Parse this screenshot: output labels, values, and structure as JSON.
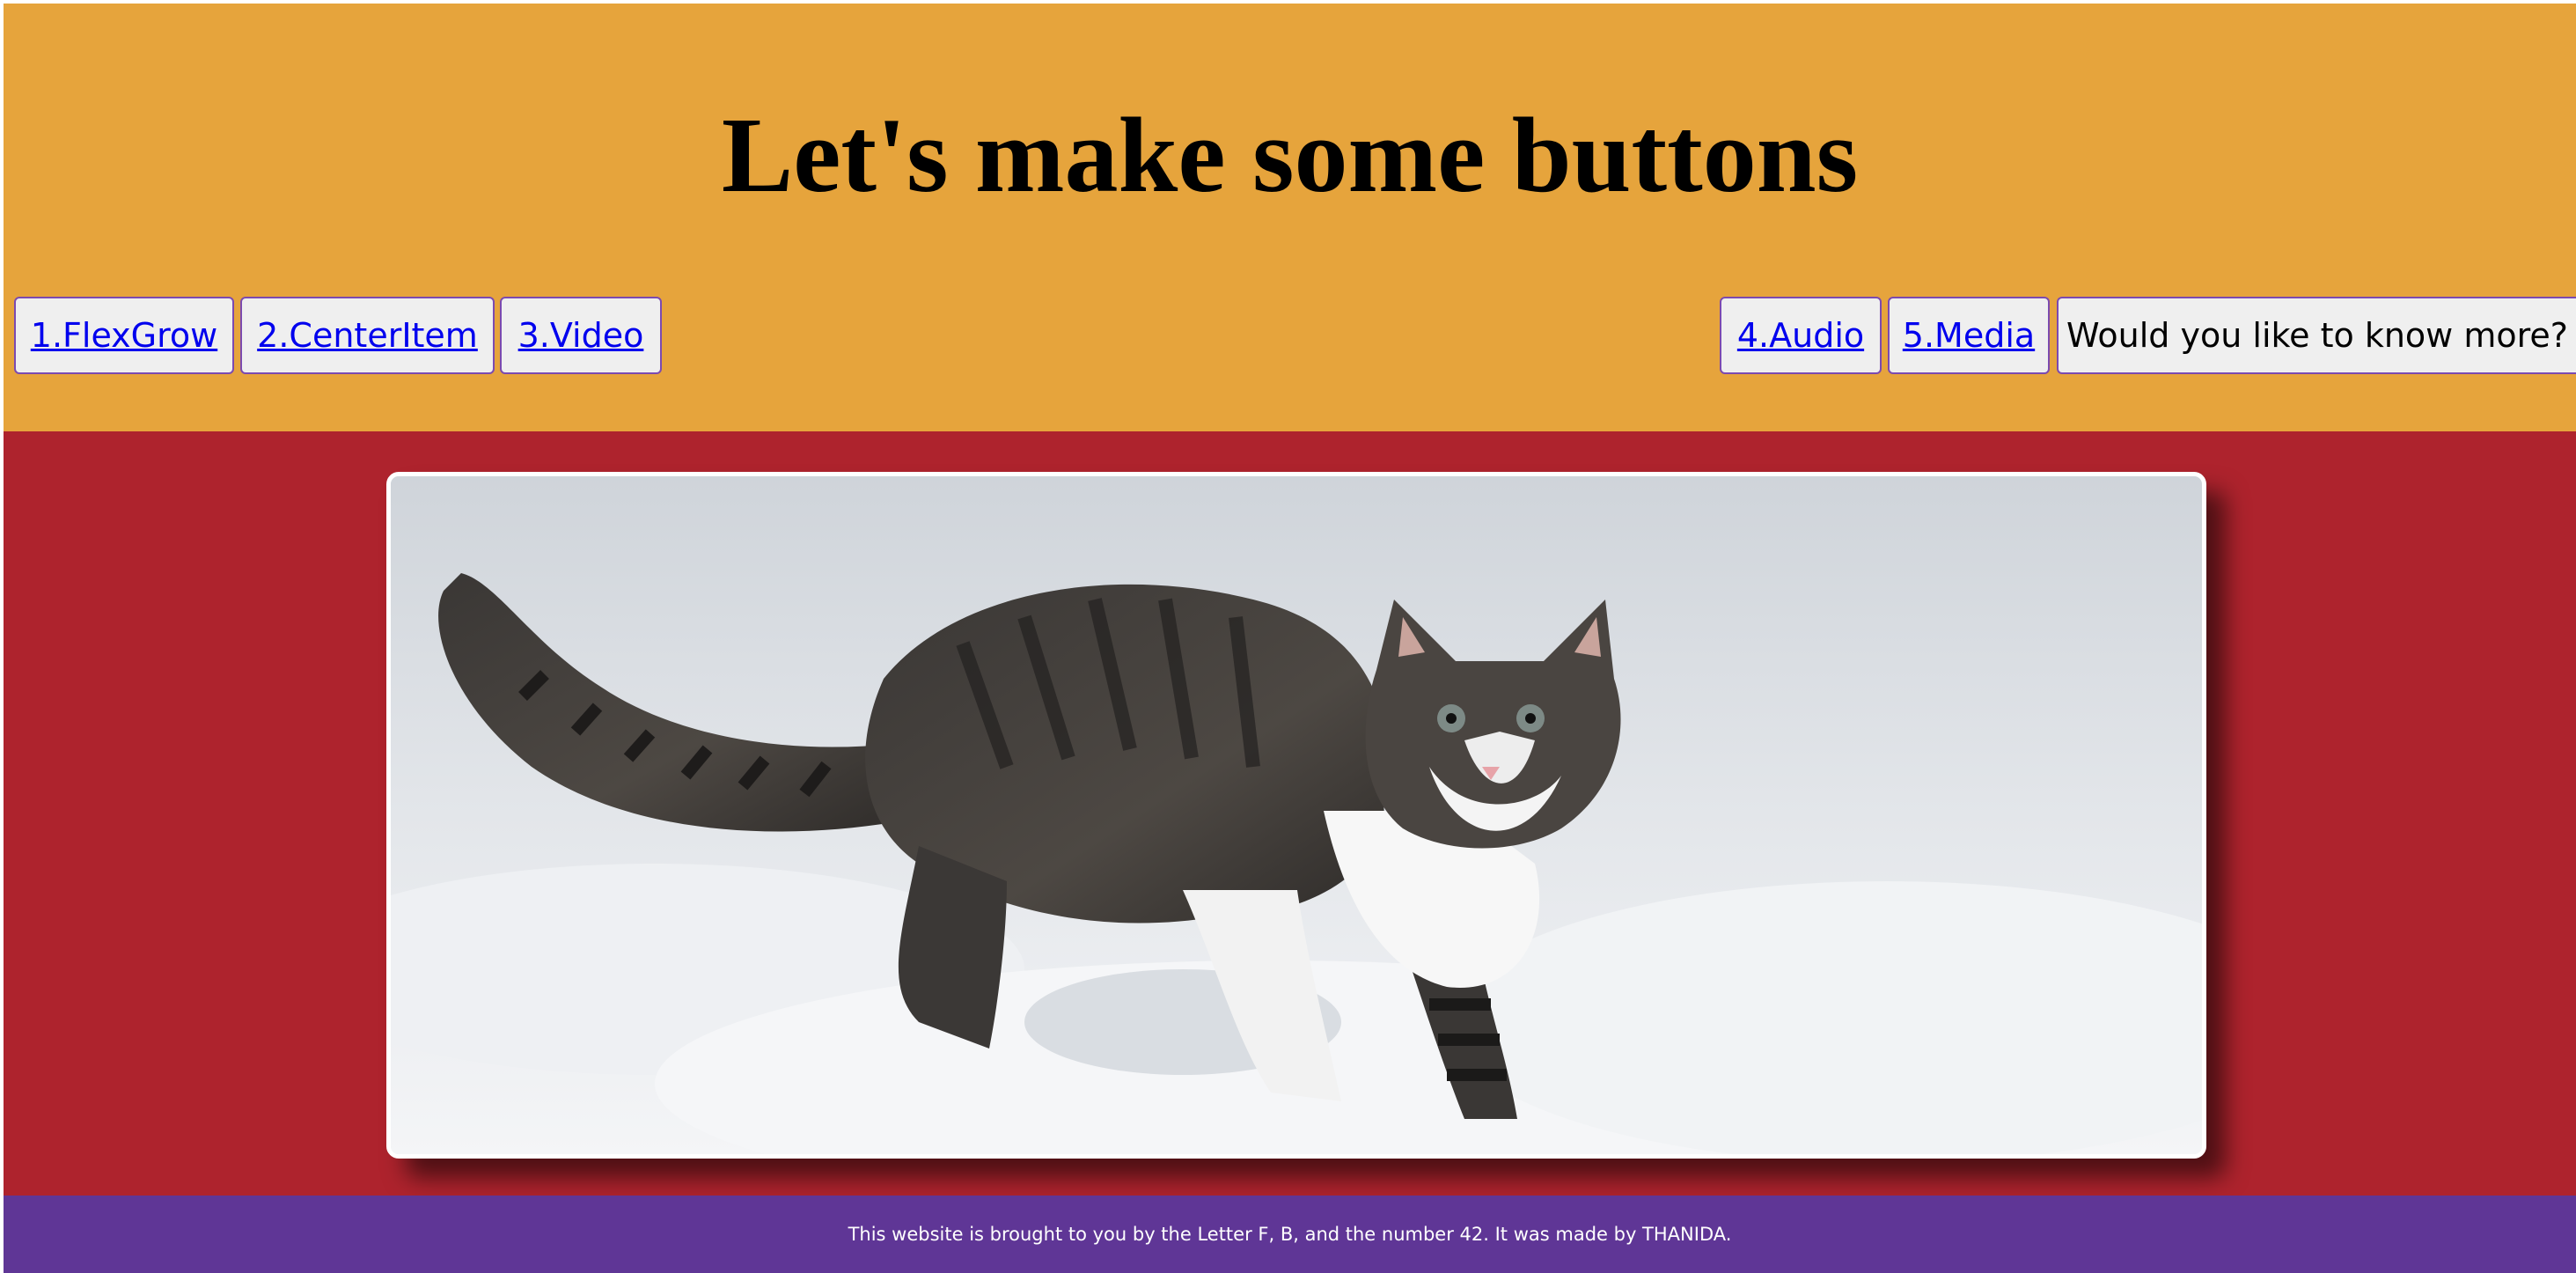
{
  "header": {
    "title": "Let's make some buttons",
    "background": "#e6a43c"
  },
  "nav": {
    "left_buttons": [
      {
        "label": "1.FlexGrow"
      },
      {
        "label": "2.CenterItem"
      },
      {
        "label": "3.Video"
      }
    ],
    "right_buttons": [
      {
        "label": "4.Audio"
      },
      {
        "label": "5.Media"
      },
      {
        "label": "Would you like to know more?"
      }
    ],
    "link_color": "#0000ee",
    "border_color": "#7b4ab0"
  },
  "main": {
    "background": "#ae232d",
    "image": {
      "subject": "kitten walking in snow",
      "icon": "cat-photo"
    }
  },
  "footer": {
    "text": "This website is brought to you by the Letter F, B, and the number 42. It was made by THANIDA.",
    "background": "#5f3696"
  }
}
